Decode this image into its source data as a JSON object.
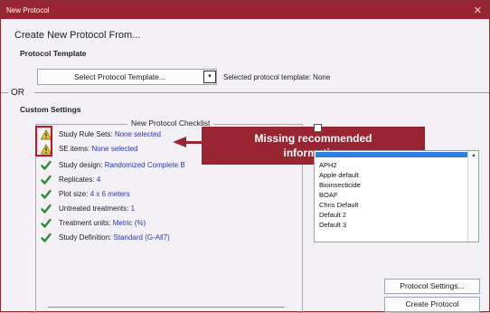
{
  "window": {
    "title": "New Protocol",
    "close_glyph": "✕"
  },
  "header": {
    "create_from": "Create New Protocol From...",
    "protocol_template_label": "Protocol Template"
  },
  "template": {
    "select_button_label": "Select Protocol Template...",
    "dropdown_glyph": "▾",
    "selected_template_text": "Selected protocol template: None"
  },
  "or_separator": "OR",
  "custom_settings": {
    "label": "Custom Settings",
    "checklist_title": "New Protocol Checklist",
    "items": [
      {
        "status": "warning",
        "label": "Study Rule Sets:",
        "value": "None selected"
      },
      {
        "status": "warning",
        "label": "SE items:",
        "value": "None selected"
      },
      {
        "status": "ok",
        "label": "Study design:",
        "value": "Randomized Complete B"
      },
      {
        "status": "ok",
        "label": "Replicates:",
        "value": "4"
      },
      {
        "status": "ok",
        "label": "Plot size:",
        "value": "4 x 6 meters"
      },
      {
        "status": "ok",
        "label": "Untreated treatments:",
        "value": "1"
      },
      {
        "status": "ok",
        "label": "Treatment units:",
        "value": "Metric (%)"
      },
      {
        "status": "ok",
        "label": "Study Definition:",
        "value": "Standard (G-All7)"
      }
    ]
  },
  "callout": {
    "line1": "Missing recommended",
    "line2": "information"
  },
  "rule_sets_list": {
    "items": [
      "APH2",
      "Apple default",
      "Bioinsecticide",
      "BOAF",
      "Chris Default",
      "Default 2",
      "Default 3"
    ]
  },
  "buttons": {
    "protocol_settings": "Protocol Settings...",
    "create_protocol": "Create Protocol"
  },
  "colors": {
    "brand": "#9a2532",
    "link_value": "#2a36b8",
    "check_green": "#2e8a2e",
    "warning_yellow": "#f2cc1b"
  }
}
